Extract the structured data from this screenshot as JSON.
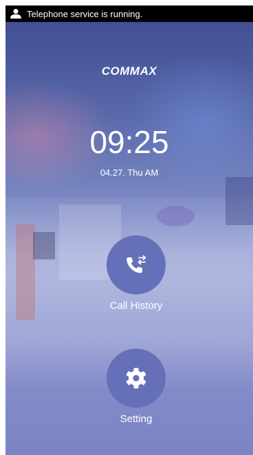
{
  "status_bar": {
    "icon": "user-icon",
    "text": "Telephone service is running."
  },
  "brand": {
    "logo": "COMMAX"
  },
  "clock": {
    "time": "09:25",
    "date": "04.27. Thu AM"
  },
  "actions": {
    "call_history": {
      "label": "Call History",
      "icon": "phone-transfer-icon"
    },
    "setting": {
      "label": "Setting",
      "icon": "gear-icon"
    }
  },
  "colors": {
    "status_bar_bg": "#000000",
    "button_circle": "#6570b9",
    "text": "#ffffff"
  }
}
